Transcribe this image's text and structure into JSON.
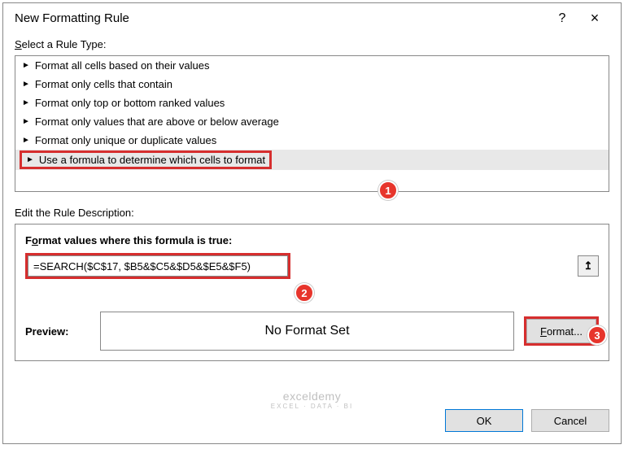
{
  "window": {
    "title": "New Formatting Rule",
    "help": "?",
    "close": "×"
  },
  "ruleType": {
    "label_pre": "S",
    "label_rest": "elect a Rule Type:",
    "items": [
      "Format all cells based on their values",
      "Format only cells that contain",
      "Format only top or bottom ranked values",
      "Format only values that are above or below average",
      "Format only unique or duplicate values",
      "Use a formula to determine which cells to format"
    ]
  },
  "description": {
    "label": "Edit the Rule Description:",
    "formulaLabel_pre": "F",
    "formulaLabel_u": "o",
    "formulaLabel_rest": "rmat values where this formula is true:",
    "formula": "=SEARCH($C$17, $B5&$C5&$D5&$E5&$F5)",
    "refIcon": "↥"
  },
  "preview": {
    "label": "Preview:",
    "text": "No Format Set",
    "formatBtn_u": "F",
    "formatBtn_rest": "ormat..."
  },
  "footer": {
    "ok": "OK",
    "cancel": "Cancel"
  },
  "badges": {
    "b1": "1",
    "b2": "2",
    "b3": "3"
  },
  "watermark": {
    "main": "exceldemy",
    "sub": "EXCEL · DATA · BI"
  }
}
